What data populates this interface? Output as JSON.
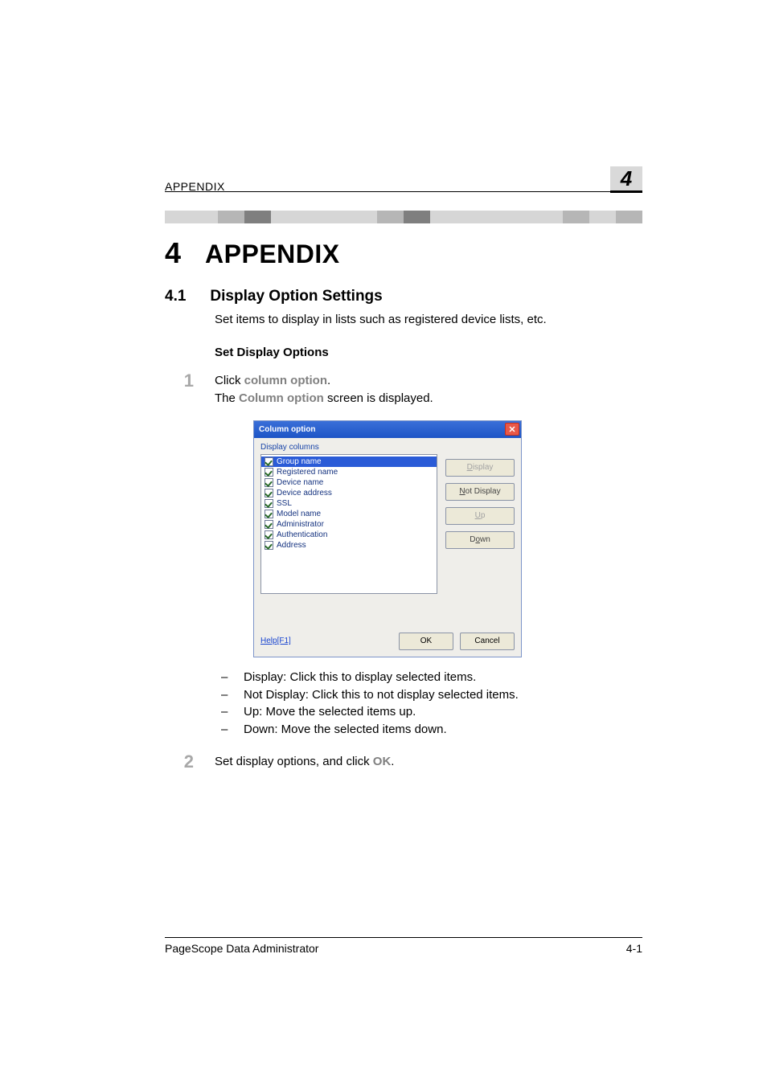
{
  "header": {
    "running_title": "APPENDIX",
    "chapter_tab": "4"
  },
  "headings": {
    "h1_num": "4",
    "h1_title": "APPENDIX",
    "h2_num": "4.1",
    "h2_title": "Display Option Settings",
    "h3": "Set Display Options"
  },
  "body": {
    "intro": "Set items to display in lists such as registered device lists, etc."
  },
  "steps": {
    "s1_num": "1",
    "s1_prefix": "Click ",
    "s1_action": "column option",
    "s1_suffix": ".",
    "s1_line2_prefix": "The ",
    "s1_line2_emph": "Column option",
    "s1_line2_suffix": " screen is displayed.",
    "s2_num": "2",
    "s2_prefix": "Set display options, and click ",
    "s2_action": "OK",
    "s2_suffix": "."
  },
  "bullets": {
    "b1": "Display: Click this to display selected items.",
    "b2": "Not Display: Click this to not display selected items.",
    "b3": "Up: Move the selected items up.",
    "b4": "Down: Move the selected items down."
  },
  "dialog": {
    "title": "Column option",
    "label": "Display columns",
    "items": {
      "i0": "Group name",
      "i1": "Registered name",
      "i2": "Device name",
      "i3": "Device address",
      "i4": "SSL",
      "i5": "Model name",
      "i6": "Administrator",
      "i7": "Authentication",
      "i8": "Address"
    },
    "buttons": {
      "display_u": "D",
      "display_rest": "isplay",
      "notdisplay_prefix": "",
      "notdisplay_u": "N",
      "notdisplay_rest": "ot Display",
      "up_u": "U",
      "up_rest": "p",
      "down_prefix": "D",
      "down_u": "o",
      "down_rest": "wn",
      "ok": "OK",
      "cancel": "Cancel"
    },
    "help": "Help[F1]"
  },
  "footer": {
    "left": "PageScope Data Administrator",
    "right": "4-1"
  }
}
